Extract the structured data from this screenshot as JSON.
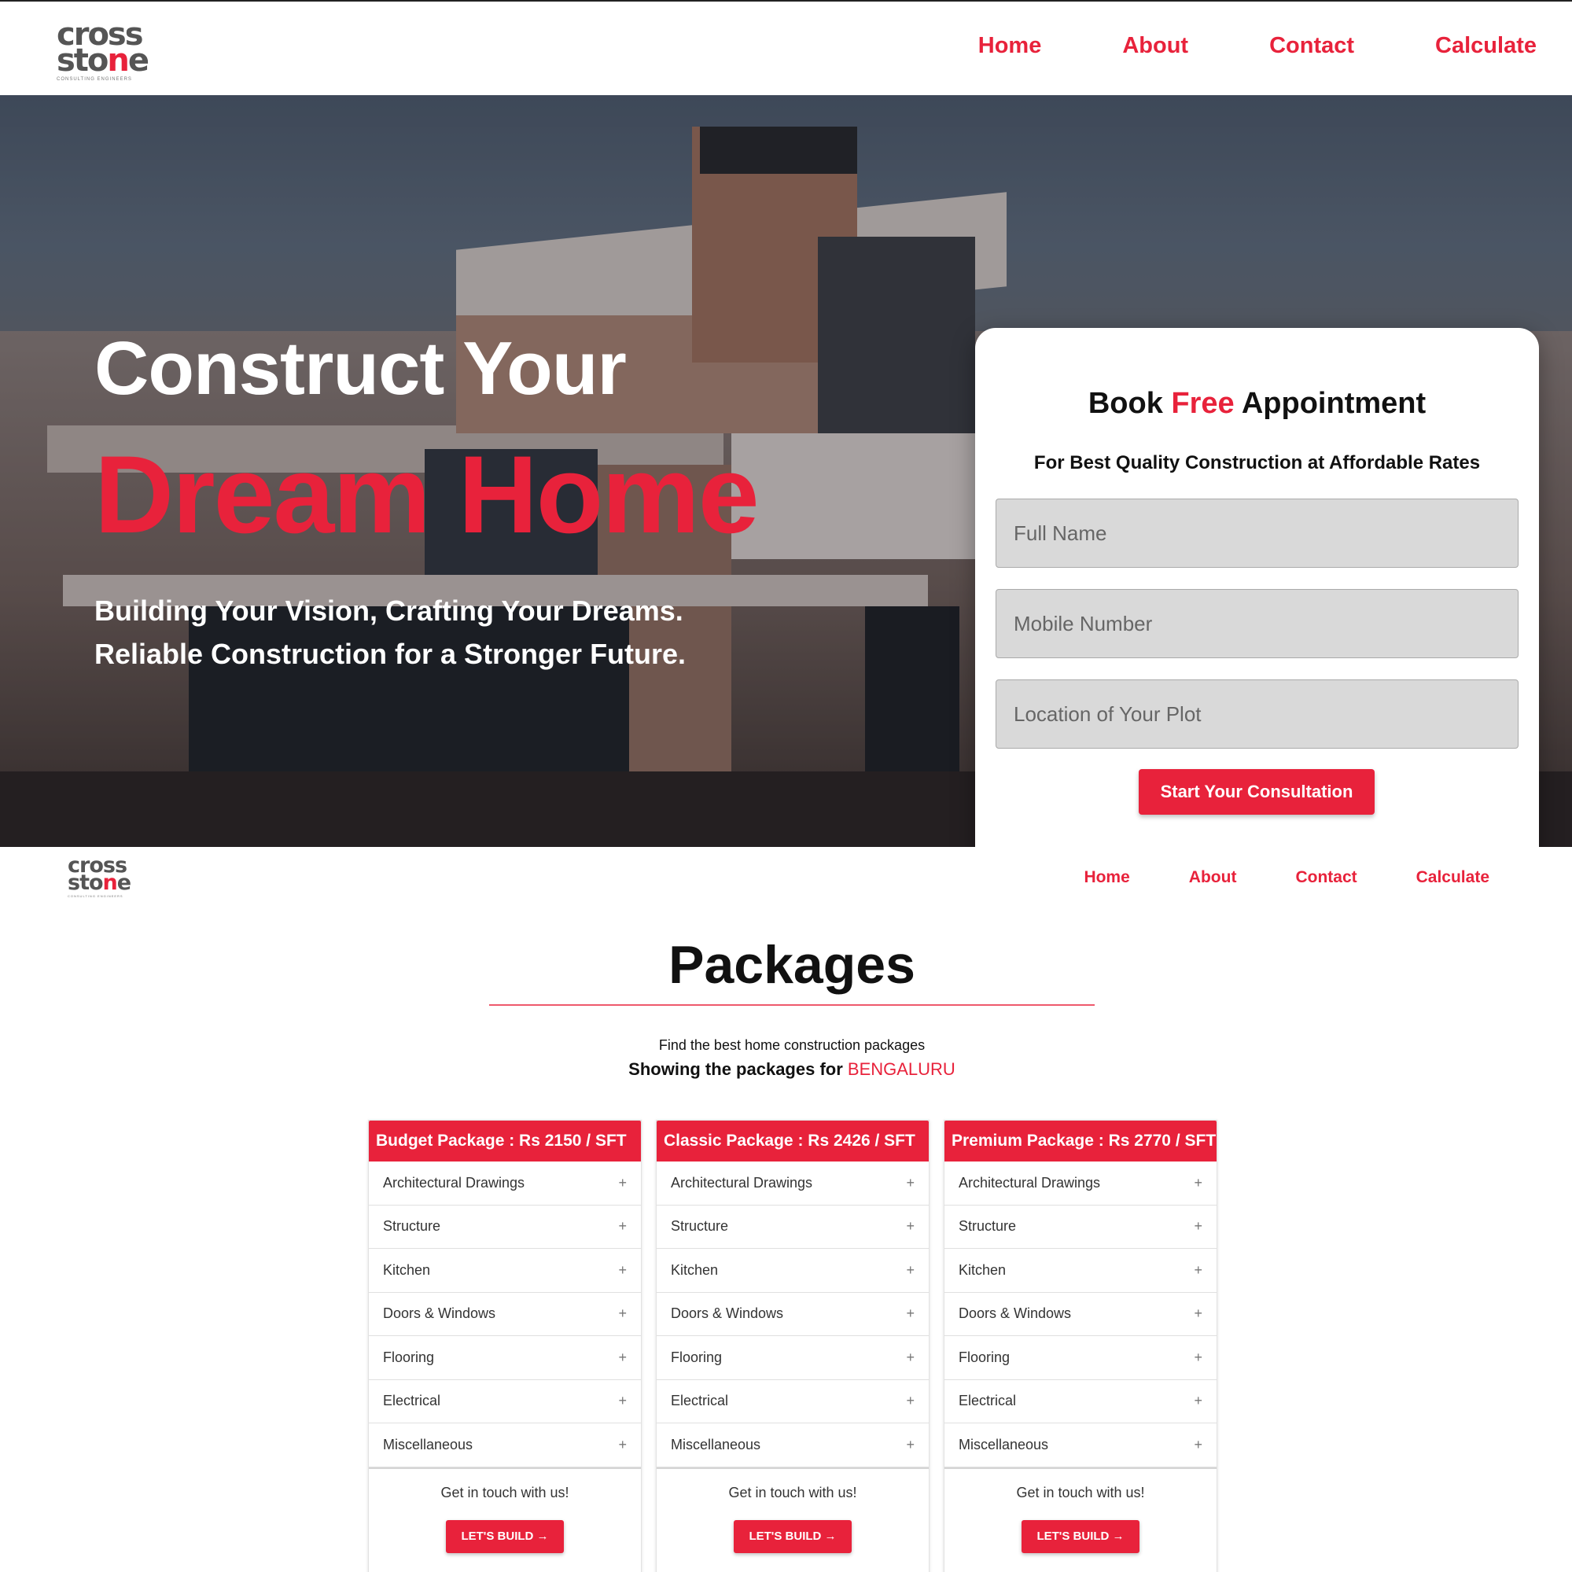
{
  "brand": {
    "line1": "cross",
    "line2_start": "sto",
    "line2_red": "n",
    "line2_end": "e",
    "tagline": "CONSULTING ENGINEERS"
  },
  "nav": {
    "items": [
      "Home",
      "About",
      "Contact",
      "Calculate"
    ]
  },
  "hero": {
    "heading_line1": "Construct Your",
    "heading_line2": "Dream Home",
    "sub_line1": "Building Your Vision, Crafting Your Dreams.",
    "sub_line2": "Reliable Construction for a Stronger Future."
  },
  "form": {
    "title_start": "Book ",
    "title_red": "Free",
    "title_end": " Appointment",
    "subtitle": "For Best Quality Construction at Affordable Rates",
    "fields": [
      {
        "placeholder": "Full Name"
      },
      {
        "placeholder": "Mobile Number"
      },
      {
        "placeholder": "Location of Your Plot"
      }
    ],
    "submit_label": "Start Your Consultation"
  },
  "packages": {
    "title": "Packages",
    "find_text": "Find the best home construction packages",
    "showing_prefix": "Showing the packages for ",
    "city": "BENGALURU",
    "cards": [
      {
        "header": "Budget Package : Rs 2150 / SFT"
      },
      {
        "header": "Classic Package : Rs 2426 / SFT"
      },
      {
        "header": "Premium Package : Rs 2770 / SFT"
      }
    ],
    "items": [
      "Architectural Drawings",
      "Structure",
      "Kitchen",
      "Doors & Windows",
      "Flooring",
      "Electrical",
      "Miscellaneous"
    ],
    "expand_symbol": "+",
    "contact_text": "Get in touch with us!",
    "cta_label": "LET'S BUILD →"
  },
  "colors": {
    "accent": "#e8223b",
    "logo_gray": "#555555",
    "field_bg": "#d9d9d9"
  }
}
